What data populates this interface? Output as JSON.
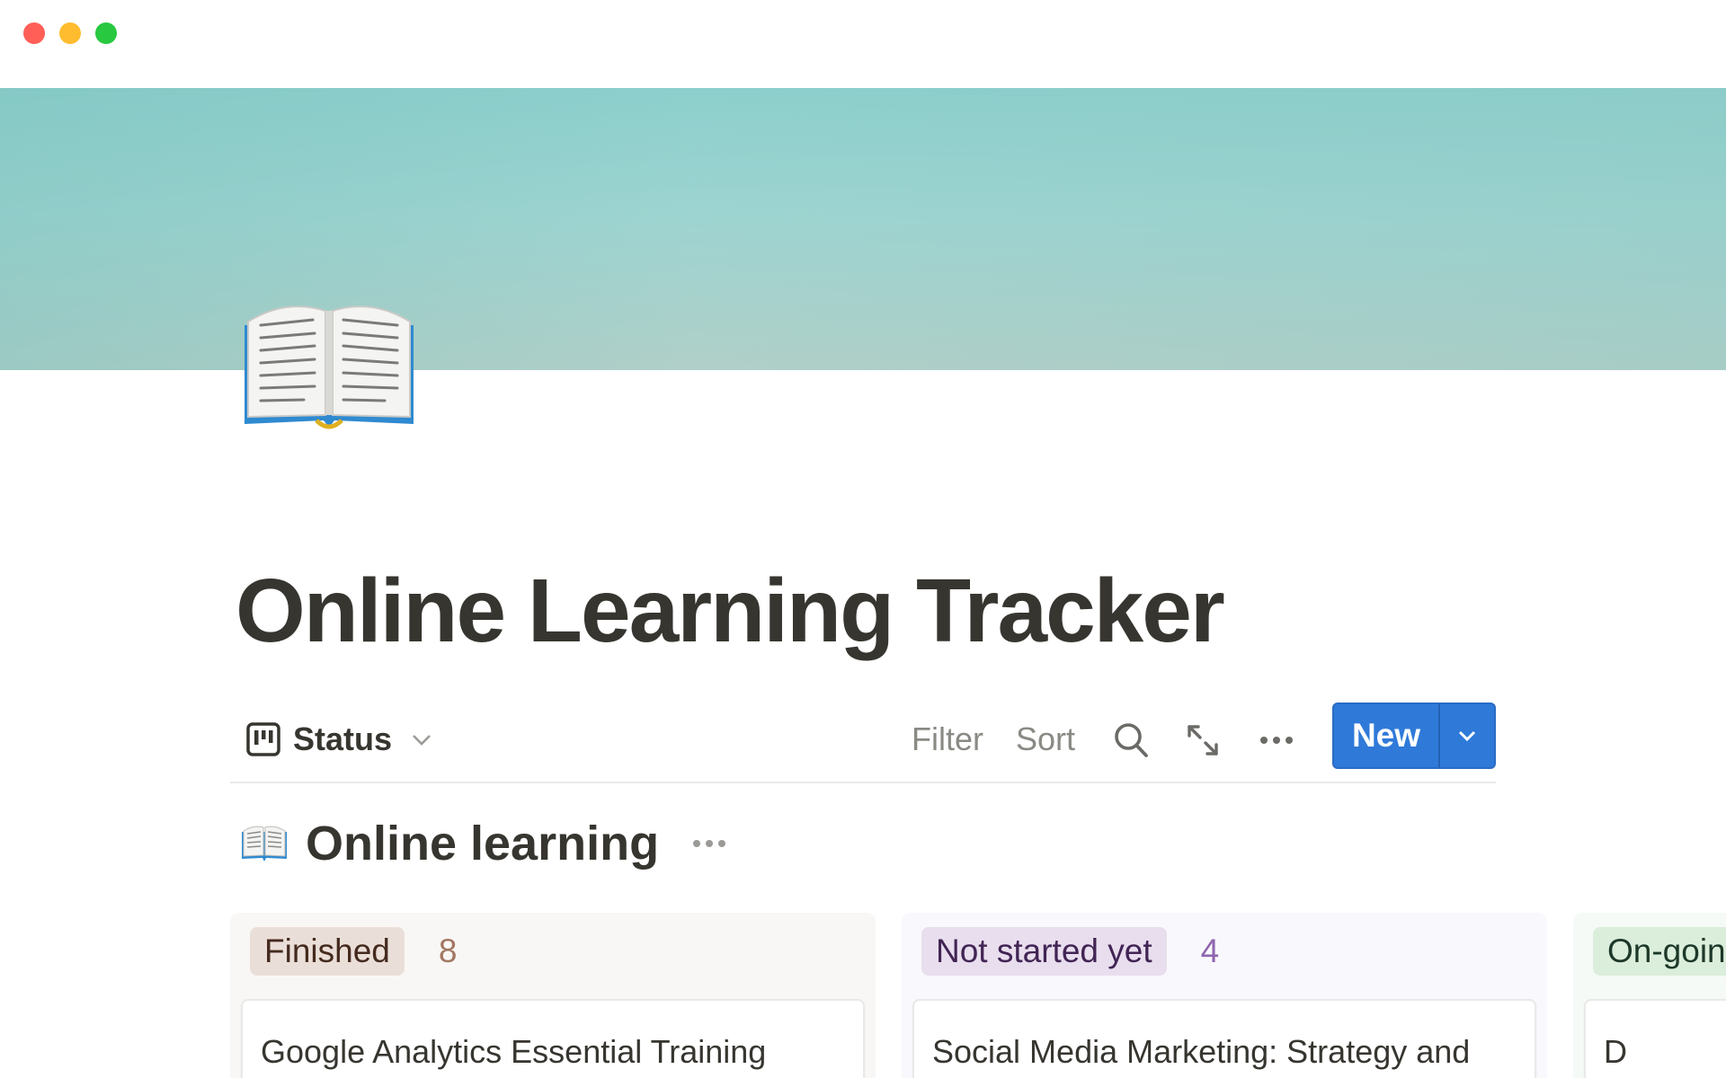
{
  "window": {
    "controls": [
      "close",
      "minimize",
      "maximize"
    ]
  },
  "cover": {
    "colors": [
      "#8ccfcc",
      "#b0cfc8"
    ]
  },
  "page": {
    "icon": "open-book-icon",
    "title": "Online Learning Tracker"
  },
  "toolbar": {
    "view_label": "Status",
    "view_icon": "board-view-icon",
    "filter_label": "Filter",
    "sort_label": "Sort",
    "icons": [
      "search-icon",
      "expand-icon",
      "more-icon"
    ],
    "new_label": "New",
    "accent": "#2f7ad9"
  },
  "database": {
    "icon": "open-book-icon",
    "title": "Online learning"
  },
  "board": {
    "columns": [
      {
        "label": "Finished",
        "count": "8",
        "cards": [
          {
            "title": "Google Analytics Essential Training"
          }
        ]
      },
      {
        "label": "Not started yet",
        "count": "4",
        "cards": [
          {
            "title": "Social Media Marketing: Strategy and"
          }
        ]
      },
      {
        "label": "On-goin",
        "count": "",
        "cards": [
          {
            "title": "D"
          }
        ]
      }
    ]
  }
}
